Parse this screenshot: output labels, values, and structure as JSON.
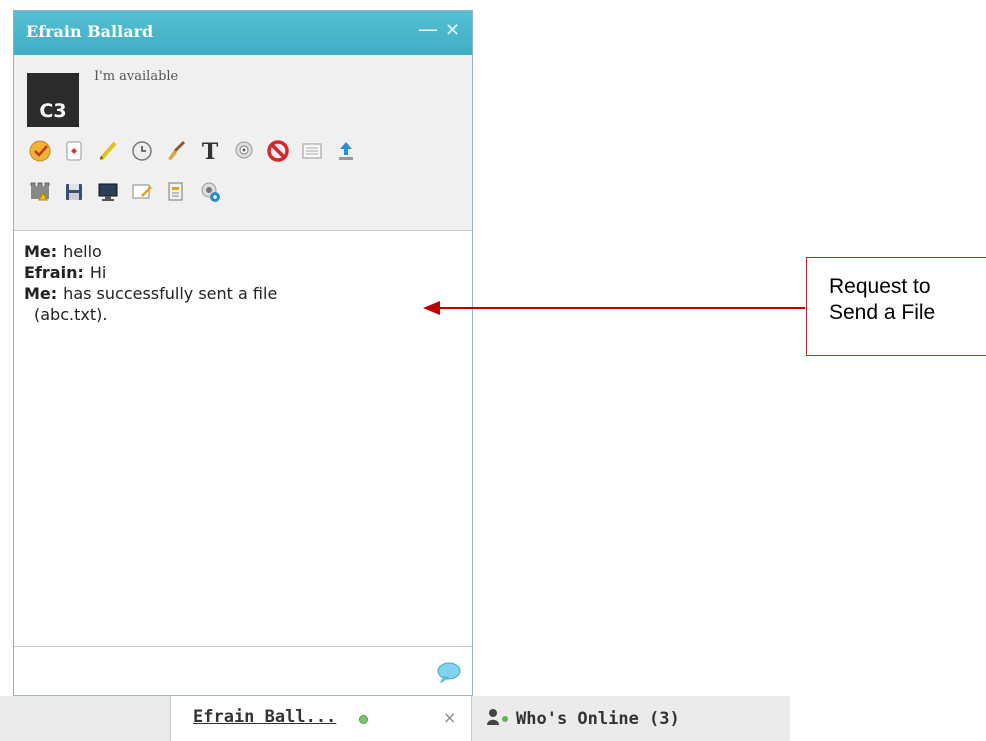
{
  "chat": {
    "title": "Efrain Ballard",
    "minimize": "—",
    "close": "✕",
    "avatar_text": "C3",
    "status": "I'm available",
    "messages": [
      {
        "sender": "Me:",
        "text": "hello",
        "cont": ""
      },
      {
        "sender": "Efrain:",
        "text": "Hi",
        "cont": ""
      },
      {
        "sender": "Me:",
        "text": "has successfully sent a file",
        "cont": "(abc.txt)."
      }
    ],
    "input_value": ""
  },
  "taskbar": {
    "tab_label": "Efrain Ball...",
    "tab_close": "×",
    "whos_online": "Who's Online (3)"
  },
  "annotation": {
    "line1": "Request to",
    "line2": "Send a File"
  },
  "colors": {
    "header": "#40aec4",
    "arrow": "#c00000",
    "online": "#7cc56f"
  }
}
